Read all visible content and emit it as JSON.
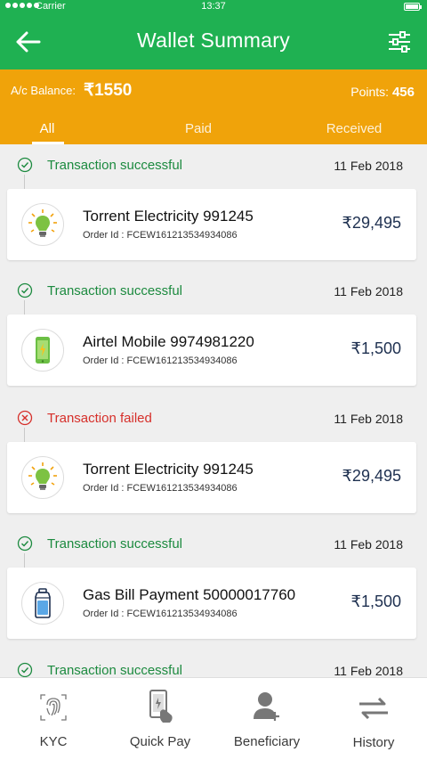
{
  "status_bar": {
    "carrier": "Carrier",
    "time": "13:37"
  },
  "header": {
    "title": "Wallet Summary"
  },
  "balance": {
    "label": "A/c Balance:",
    "value": "₹1550",
    "points_label": "Points:",
    "points_value": "456"
  },
  "tabs": [
    {
      "label": "All",
      "active": true
    },
    {
      "label": "Paid",
      "active": false
    },
    {
      "label": "Received",
      "active": false
    }
  ],
  "transactions": [
    {
      "status": "Transaction successful",
      "result": "success",
      "date": "11 Feb 2018",
      "name": "Torrent Electricity 991245",
      "order": "Order Id : FCEW161213534934086",
      "amount": "₹29,495",
      "icon": "bulb-icon"
    },
    {
      "status": "Transaction successful",
      "result": "success",
      "date": "11 Feb 2018",
      "name": "Airtel Mobile 9974981220",
      "order": "Order Id : FCEW161213534934086",
      "amount": "₹1,500",
      "icon": "mobile-icon"
    },
    {
      "status": "Transaction failed",
      "result": "failed",
      "date": "11 Feb 2018",
      "name": "Torrent Electricity 991245",
      "order": "Order Id : FCEW161213534934086",
      "amount": "₹29,495",
      "icon": "bulb-icon"
    },
    {
      "status": "Transaction successful",
      "result": "success",
      "date": "11 Feb 2018",
      "name": "Gas Bill Payment 50000017760",
      "order": "Order Id : FCEW161213534934086",
      "amount": "₹1,500",
      "icon": "gas-cylinder-icon"
    },
    {
      "status": "Transaction successful",
      "result": "success",
      "date": "11 Feb 2018"
    }
  ],
  "bottom_nav": [
    {
      "label": "KYC",
      "icon": "fingerprint-icon"
    },
    {
      "label": "Quick Pay",
      "icon": "quick-pay-icon"
    },
    {
      "label": "Beneficiary",
      "icon": "add-user-icon"
    },
    {
      "label": "History",
      "icon": "history-icon"
    }
  ],
  "colors": {
    "primary": "#1fb152",
    "accent": "#f0a30a",
    "success": "#1c8a3f",
    "failed": "#d62f2a",
    "amount": "#1e3050"
  }
}
